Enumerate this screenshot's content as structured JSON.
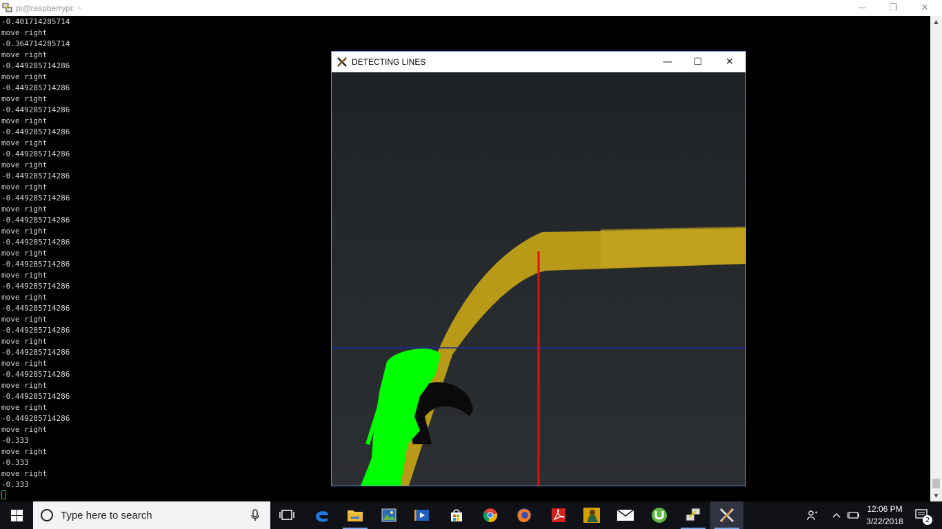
{
  "putty": {
    "title": "pi@raspberrypi: ~",
    "terminal_lines": [
      "-0.401714285714",
      "move right",
      "-0.364714285714",
      "move right",
      "-0.449285714286",
      "move right",
      "-0.449285714286",
      "move right",
      "-0.449285714286",
      "move right",
      "-0.449285714286",
      "move right",
      "-0.449285714286",
      "move right",
      "-0.449285714286",
      "move right",
      "-0.449285714286",
      "move right",
      "-0.449285714286",
      "move right",
      "-0.449285714286",
      "move right",
      "-0.449285714286",
      "move right",
      "-0.449285714286",
      "move right",
      "-0.449285714286",
      "move right",
      "-0.449285714286",
      "move right",
      "-0.449285714286",
      "move right",
      "-0.449285714286",
      "move right",
      "-0.449285714286",
      "move right",
      "-0.449285714286",
      "move right",
      "-0.333",
      "move right",
      "-0.333",
      "move right",
      "-0.333"
    ]
  },
  "cv_window": {
    "title": "DETECTING LINES"
  },
  "taskbar": {
    "search_placeholder": "Type here to search",
    "apps": [
      "task-view",
      "edge",
      "file-explorer",
      "photos",
      "movies",
      "store",
      "chrome",
      "firefox",
      "acrobat",
      "game",
      "mail",
      "utorrent",
      "network",
      "xming"
    ],
    "time": "12:06 PM",
    "date": "3/22/2018",
    "notification_count": "2"
  },
  "colors": {
    "track_yellow": "#c8a820",
    "guide_red": "#e01010",
    "guide_blue": "#1a2a9a",
    "detected_green": "#00ff00"
  }
}
